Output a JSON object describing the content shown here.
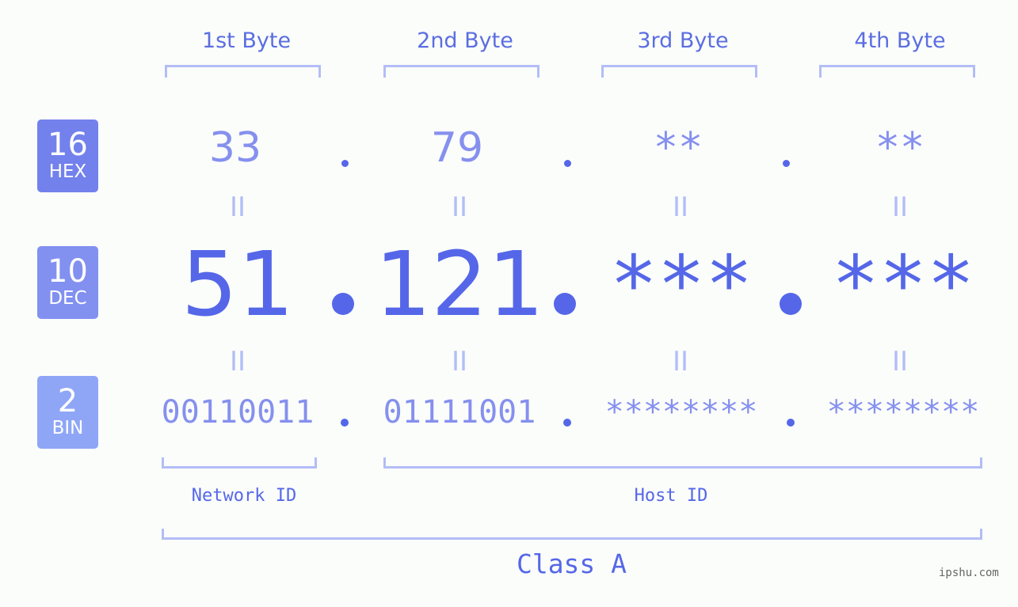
{
  "bases": [
    {
      "number": "16",
      "label": "HEX",
      "color": "#7381ec"
    },
    {
      "number": "10",
      "label": "DEC",
      "color": "#8290f0"
    },
    {
      "number": "2",
      "label": "BIN",
      "color": "#8fa6f7"
    }
  ],
  "byte_headers": [
    "1st Byte",
    "2nd Byte",
    "3rd Byte",
    "4th Byte"
  ],
  "hex": [
    "33",
    "79",
    "**",
    "**"
  ],
  "dec": [
    "51",
    "121",
    "***",
    "***"
  ],
  "bin": [
    "00110011",
    "01111001",
    "********",
    "********"
  ],
  "separator": ".",
  "equals": "II",
  "network_label": "Network ID",
  "host_label": "Host ID",
  "class_label": "Class A",
  "watermark": "ipshu.com",
  "colors": {
    "accent": "#5567e8",
    "light": "#8590ee",
    "bracket": "#b3bdf6"
  }
}
